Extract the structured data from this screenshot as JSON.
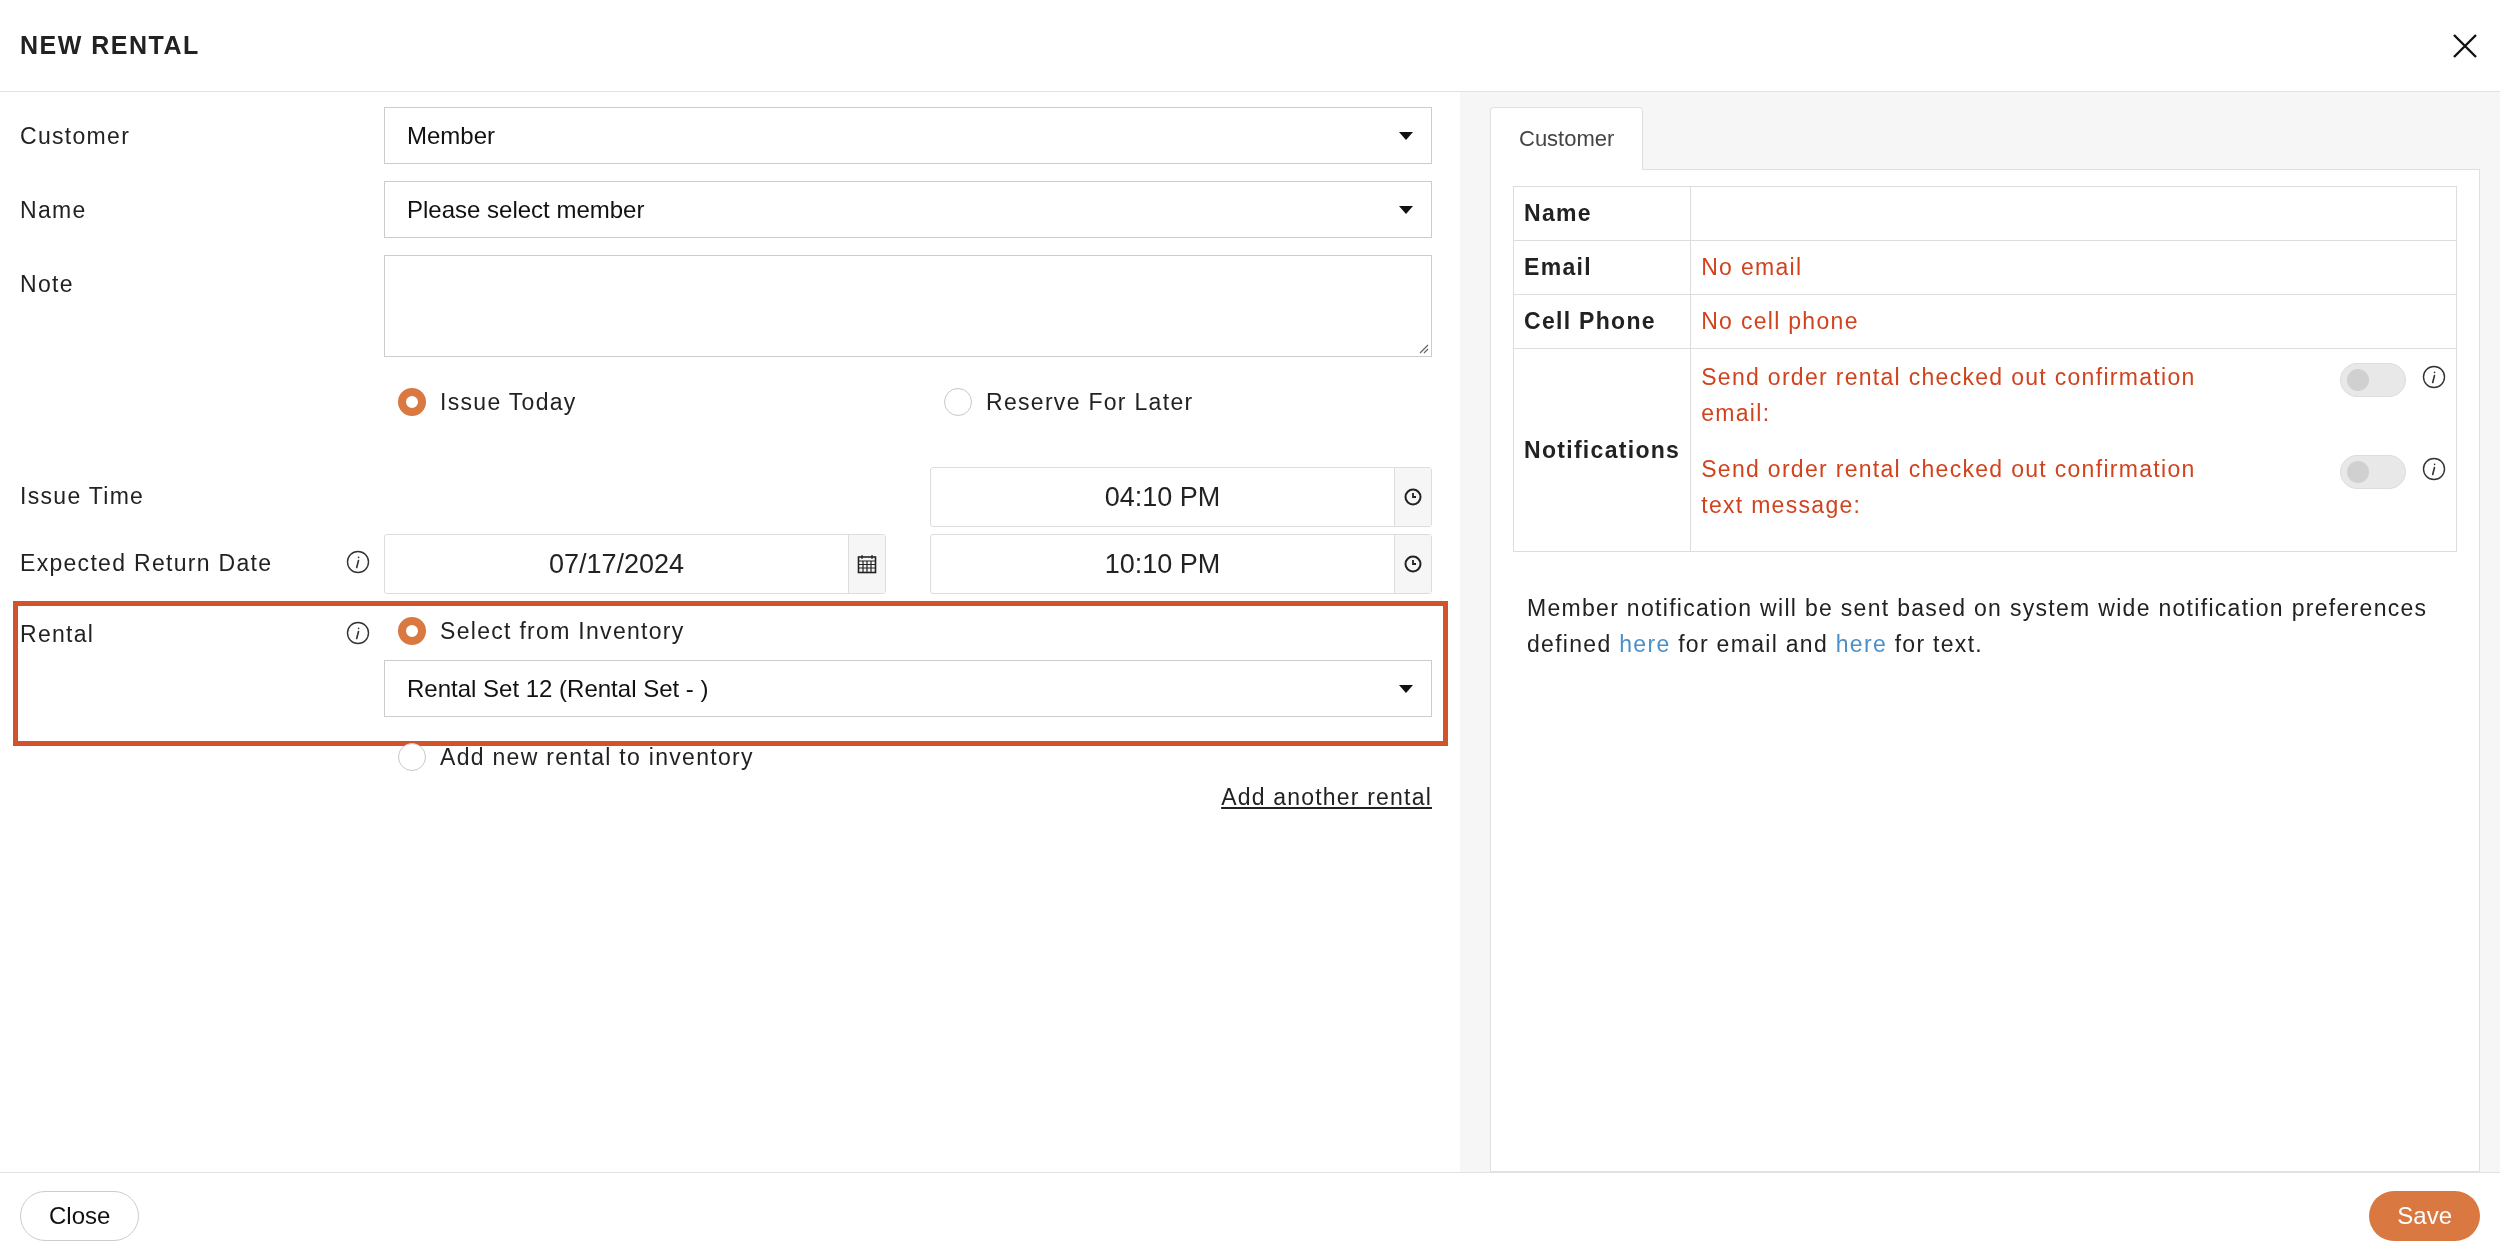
{
  "dialog": {
    "title": "NEW RENTAL"
  },
  "form": {
    "customer": {
      "label": "Customer",
      "value": "Member"
    },
    "name": {
      "label": "Name",
      "value": "Please select member"
    },
    "note": {
      "label": "Note"
    },
    "issue_options": [
      {
        "label": "Issue Today",
        "selected": true
      },
      {
        "label": "Reserve For Later",
        "selected": false
      }
    ],
    "issue_time": {
      "label": "Issue Time",
      "time": "04:10 PM"
    },
    "expected_return": {
      "label": "Expected Return Date",
      "date": "07/17/2024",
      "time": "10:10 PM"
    },
    "rental": {
      "label": "Rental",
      "highlighted": true,
      "value": "Rental Set 12 (Rental Set - )",
      "options": [
        {
          "label": "Select from Inventory",
          "selected": true
        },
        {
          "label": "Add new rental to inventory",
          "selected": false
        }
      ]
    },
    "add_link": "Add another rental"
  },
  "side_panel": {
    "tabs": [
      {
        "label": "Customer",
        "selected": true
      }
    ],
    "rows": [
      {
        "kind": "text",
        "label": "Name"
      },
      {
        "kind": "text",
        "label": "Email",
        "value": "No email"
      },
      {
        "kind": "text",
        "label": "Cell Phone",
        "value": "No cell phone"
      },
      {
        "kind": "toggles",
        "label": "Notifications",
        "items": [
          {
            "text": "Send order rental checked out confirmation email:",
            "on": false
          },
          {
            "text": "Send order rental checked out confirmation text message:",
            "on": false
          }
        ]
      }
    ],
    "note": [
      {
        "kind": "text",
        "text": "Member notification will be sent based on system wide notification preferences defined "
      },
      {
        "kind": "link",
        "text": "here"
      },
      {
        "kind": "text",
        "text": " for email and "
      },
      {
        "kind": "link",
        "text": "here"
      },
      {
        "kind": "text",
        "text": " for text."
      }
    ]
  },
  "footer": {
    "buttons": [
      {
        "label": "Close",
        "kind": "secondary"
      },
      {
        "label": "Save",
        "kind": "primary"
      }
    ]
  }
}
